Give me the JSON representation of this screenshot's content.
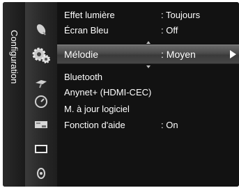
{
  "sidebar": {
    "section_label": "Configuration",
    "icons": [
      "satellite-dish-icon",
      "gear-icon",
      "input-plug-icon",
      "clock-icon",
      "speaker-icon",
      "picture-icon",
      "support-icon"
    ]
  },
  "menu": {
    "items": [
      {
        "label": "Effet lumière",
        "value": ": Toujours"
      },
      {
        "label": "Écran Bleu",
        "value": ": Off"
      },
      {
        "label": "Mélodie",
        "value": ": Moyen"
      },
      {
        "label": "Bluetooth",
        "value": ""
      },
      {
        "label": "Anynet+ (HDMI-CEC)",
        "value": ""
      },
      {
        "label": "M. à jour logiciel",
        "value": ""
      },
      {
        "label": "Fonction d'aide",
        "value": ": On"
      }
    ],
    "selected_index": 2
  }
}
